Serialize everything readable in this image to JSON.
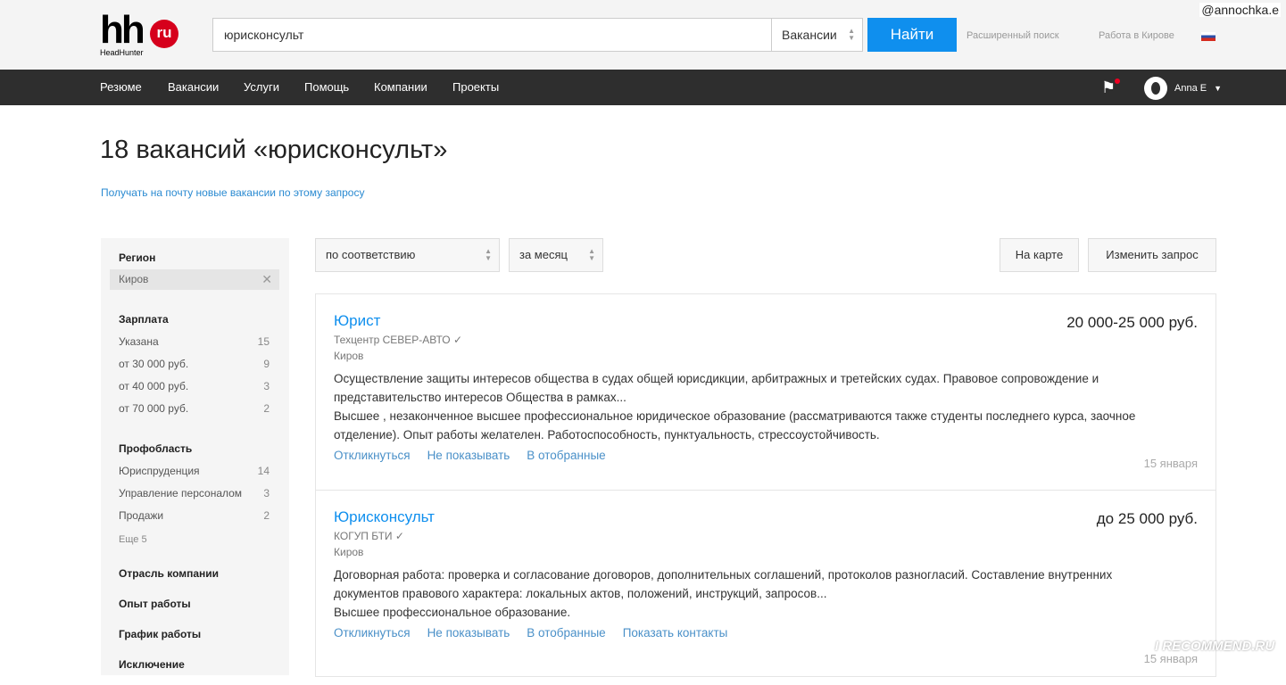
{
  "watermark_user": "@annochka.e",
  "logo": {
    "main": "hh",
    "badge": "ru",
    "sub": "HeadHunter"
  },
  "search": {
    "value": "юрисконсульт",
    "type": "Вакансии",
    "button": "Найти",
    "advanced": "Расширенный поиск",
    "city_link": "Работа в Кирове"
  },
  "nav": [
    "Резюме",
    "Вакансии",
    "Услуги",
    "Помощь",
    "Компании",
    "Проекты"
  ],
  "user": {
    "name": "Anna E"
  },
  "title": "18 вакансий «юрисконсульт»",
  "subscribe": "Получать на почту новые вакансии по этому запросу",
  "filters": {
    "region_h": "Регион",
    "region_value": "Киров",
    "salary_h": "Зарплата",
    "salary": [
      {
        "l": "Указана",
        "c": "15"
      },
      {
        "l": "от 30 000 руб.",
        "c": "9"
      },
      {
        "l": "от 40 000 руб.",
        "c": "3"
      },
      {
        "l": "от 70 000 руб.",
        "c": "2"
      }
    ],
    "prof_h": "Профобласть",
    "prof": [
      {
        "l": "Юриспруденция",
        "c": "14"
      },
      {
        "l": "Управление персоналом",
        "c": "3"
      },
      {
        "l": "Продажи",
        "c": "2"
      }
    ],
    "more": "Еще 5",
    "others": [
      "Отрасль компании",
      "Опыт работы",
      "График работы",
      "Исключение"
    ]
  },
  "sort": {
    "order": "по соответствию",
    "period": "за месяц",
    "map": "На карте",
    "change": "Изменить запрос"
  },
  "vacancies": [
    {
      "title": "Юрист",
      "salary": "20 000-25 000 руб.",
      "company": "Техцентр СЕВЕР-АВТО",
      "city": "Киров",
      "desc1": "Осуществление защиты интересов общества в судах общей юрисдикции, арбитражных и третейских судах. Правовое сопровождение и представительство интересов Общества в рамках...",
      "desc2": "Высшее , незаконченное высшее профессиональное юридическое образование (рассматриваются также студенты последнего курса, заочное отделение). Опыт работы желателен. Работоспособность, пунктуальность, стрессоустойчивость.",
      "actions": [
        "Откликнуться",
        "Не показывать",
        "В отобранные"
      ],
      "date": "15 января"
    },
    {
      "title": "Юрисконсульт",
      "salary": "до 25 000 руб.",
      "company": "КОГУП БТИ",
      "city": "Киров",
      "desc1": "Договорная работа: проверка и согласование договоров, дополнительных соглашений, протоколов разногласий. Составление внутренних документов правового характера: локальных актов, положений, инструкций, запросов...",
      "desc2": "Высшее профессиональное образование.",
      "actions": [
        "Откликнуться",
        "Не показывать",
        "В отобранные",
        "Показать контакты"
      ],
      "date": "15 января"
    }
  ],
  "recommend": "I RECOMMEND.RU"
}
